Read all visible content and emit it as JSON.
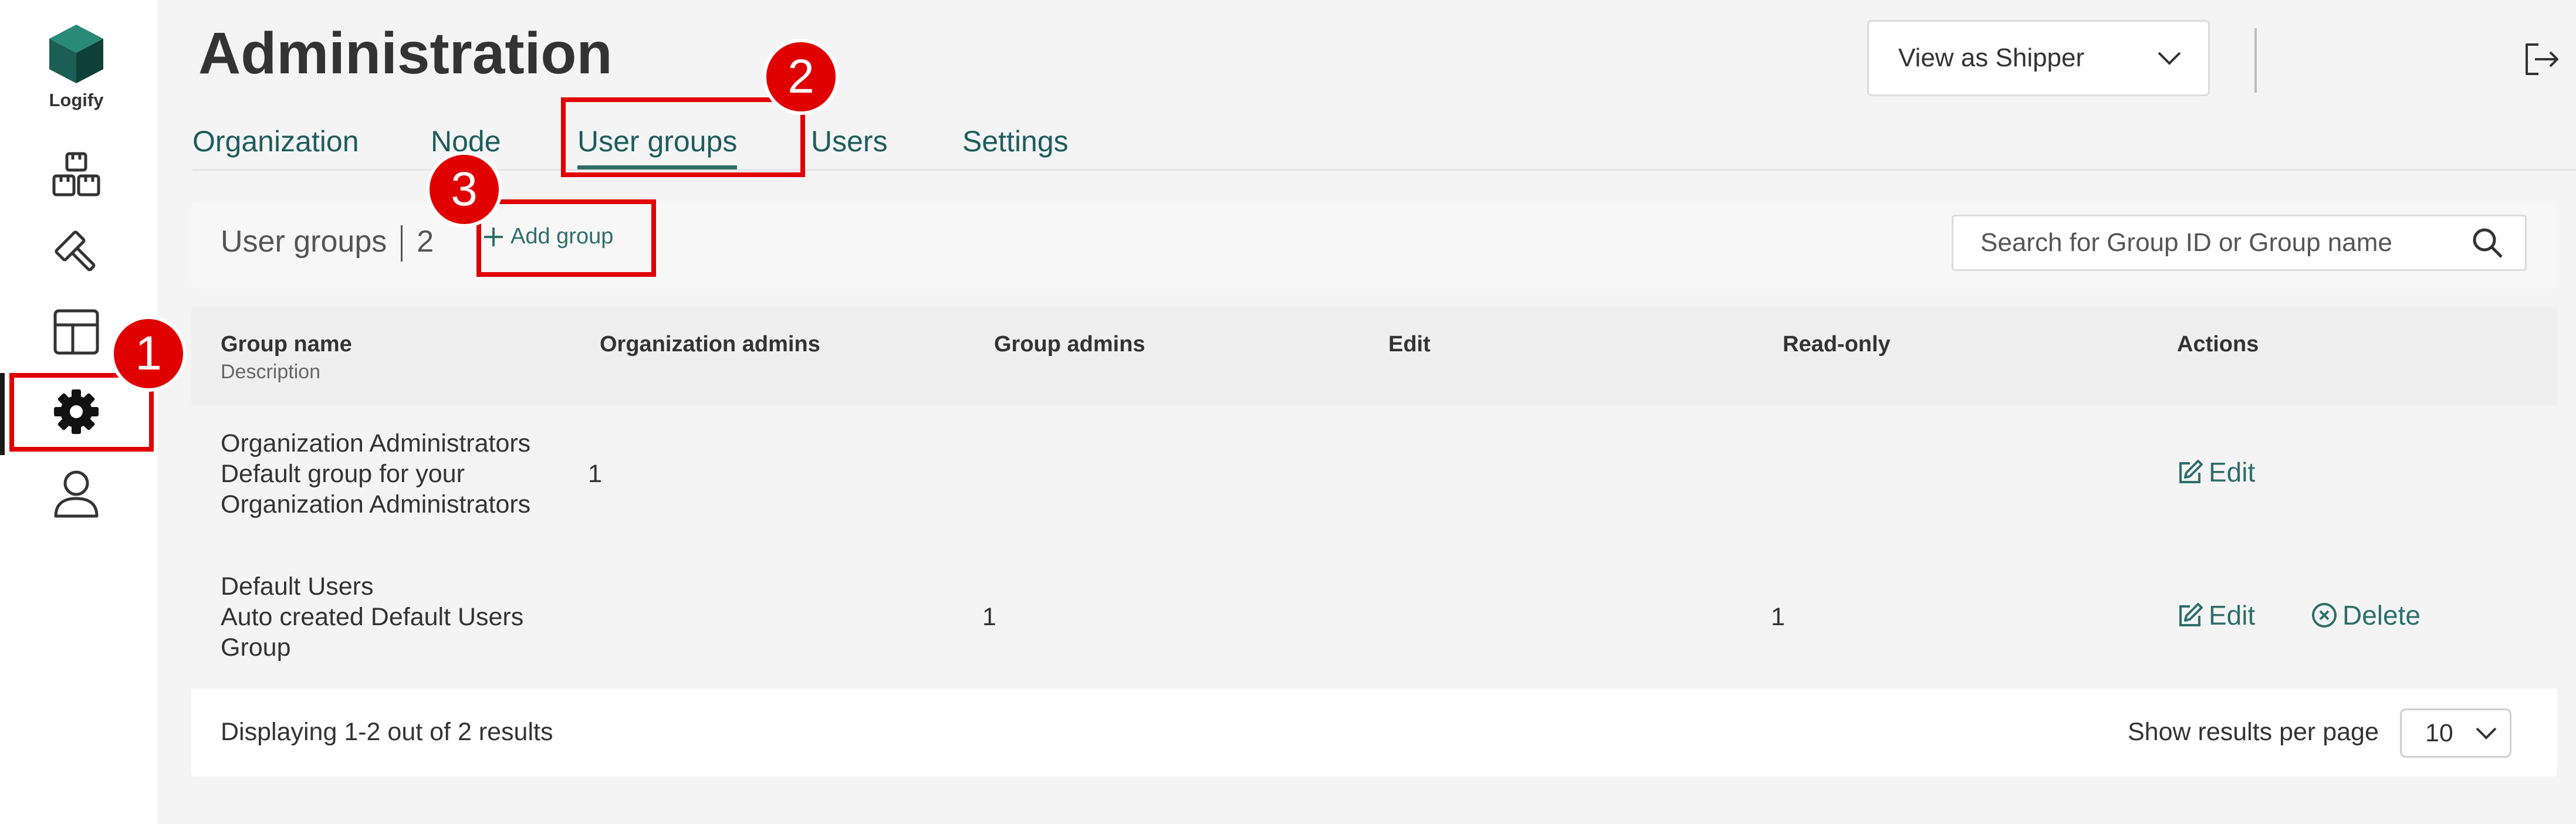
{
  "app": {
    "logo_text": "Logify"
  },
  "header": {
    "title": "Administration",
    "view_select": {
      "selected": "View as Shipper"
    }
  },
  "tabs": [
    {
      "label": "Organization"
    },
    {
      "label": "Node"
    },
    {
      "label": "User groups",
      "active": true
    },
    {
      "label": "Users"
    },
    {
      "label": "Settings"
    }
  ],
  "toolbar": {
    "label": "User groups",
    "count": "2",
    "add_label": "Add group",
    "search_placeholder": "Search for Group ID or Group name"
  },
  "table": {
    "columns": [
      {
        "label": "Group name",
        "sub": "Description"
      },
      {
        "label": "Organization admins"
      },
      {
        "label": "Group admins"
      },
      {
        "label": "Edit"
      },
      {
        "label": "Read-only"
      },
      {
        "label": "Actions"
      }
    ],
    "rows": [
      {
        "name": "Organization Administrators",
        "description_line1": "Default group for your",
        "description_line2": "Organization Administrators",
        "org_admins": "1",
        "group_admins": "",
        "edit": "",
        "read_only": "",
        "action_edit": "Edit"
      },
      {
        "name": "Default Users",
        "description_line1": "Auto created Default Users",
        "description_line2": "Group",
        "org_admins": "",
        "group_admins": "1",
        "edit": "",
        "read_only": "1",
        "action_edit": "Edit",
        "action_delete": "Delete"
      }
    ]
  },
  "footer": {
    "displaying": "Displaying 1-2 out of 2 results",
    "per_page_label": "Show results per page",
    "per_page_value": "10"
  },
  "annotations": {
    "step1": "1",
    "step2": "2",
    "step3": "3"
  },
  "colors": {
    "accent": "#2e6e6b",
    "highlight": "#e00000",
    "logo": "#1b5e55"
  },
  "icons": [
    "logo-cube-icon",
    "boxes-icon",
    "hammer-icon",
    "layout-icon",
    "gear-icon",
    "user-icon",
    "chevron-down-icon",
    "logout-icon",
    "plus-icon",
    "search-icon",
    "edit-icon",
    "delete-circle-x-icon"
  ]
}
